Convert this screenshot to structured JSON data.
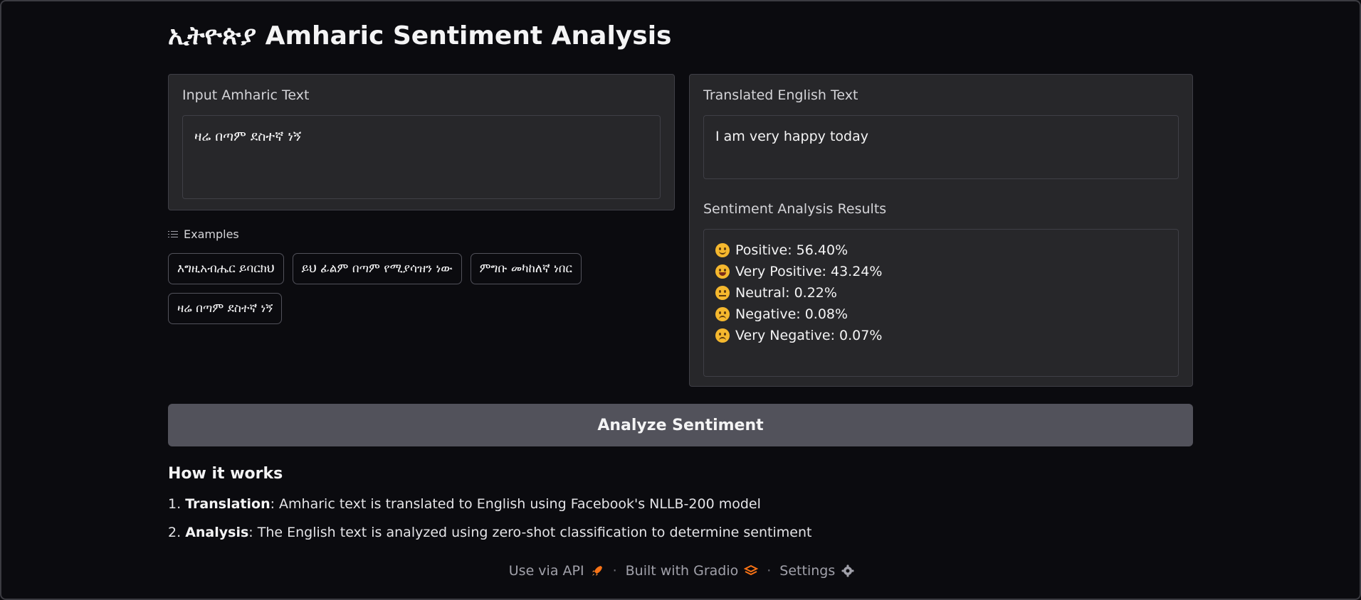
{
  "app": {
    "title": "ኢትዮጵያ Amharic Sentiment Analysis"
  },
  "input_panel": {
    "label": "Input Amharic Text",
    "value": "ዛሬ በጣም ደስተኛ ነኝ"
  },
  "examples": {
    "header": "Examples",
    "items": [
      "እግዚአብሔር ይባርክህ",
      "ይህ ፊልም በጣም የሚያሳዝን ነው",
      "ምግቡ መካከለኛ ነበር",
      "ዛሬ በጣም ደስተኛ ነኝ"
    ]
  },
  "translation_panel": {
    "label": "Translated English Text",
    "value": "I am very happy today"
  },
  "results_panel": {
    "label": "Sentiment Analysis Results",
    "items": [
      {
        "text": "Positive: 56.40%",
        "icon": "slightly-smiling-face-icon",
        "mouth": "smile"
      },
      {
        "text": "Very Positive: 43.24%",
        "icon": "grinning-face-icon",
        "mouth": "grin"
      },
      {
        "text": "Neutral: 0.22%",
        "icon": "neutral-face-icon",
        "mouth": "flat"
      },
      {
        "text": "Negative: 0.08%",
        "icon": "slightly-frowning-face-icon",
        "mouth": "frown"
      },
      {
        "text": "Very Negative: 0.07%",
        "icon": "frowning-face-icon",
        "mouth": "frown"
      }
    ]
  },
  "analyze_button": {
    "label": "Analyze Sentiment"
  },
  "how_it_works": {
    "title": "How it works",
    "steps": [
      {
        "num": "1.",
        "bold": "Translation",
        "rest": ": Amharic text is translated to English using Facebook's NLLB-200 model"
      },
      {
        "num": "2.",
        "bold": "Analysis",
        "rest": ": The English text is analyzed using zero-shot classification to determine sentiment"
      }
    ]
  },
  "footer": {
    "api_label": "Use via API",
    "built_label": "Built with Gradio",
    "settings_label": "Settings",
    "separator": "·"
  },
  "colors": {
    "background": "#0b0b0f",
    "panel": "#27272a",
    "button": "#52525b",
    "accent_orange": "#f97316"
  }
}
